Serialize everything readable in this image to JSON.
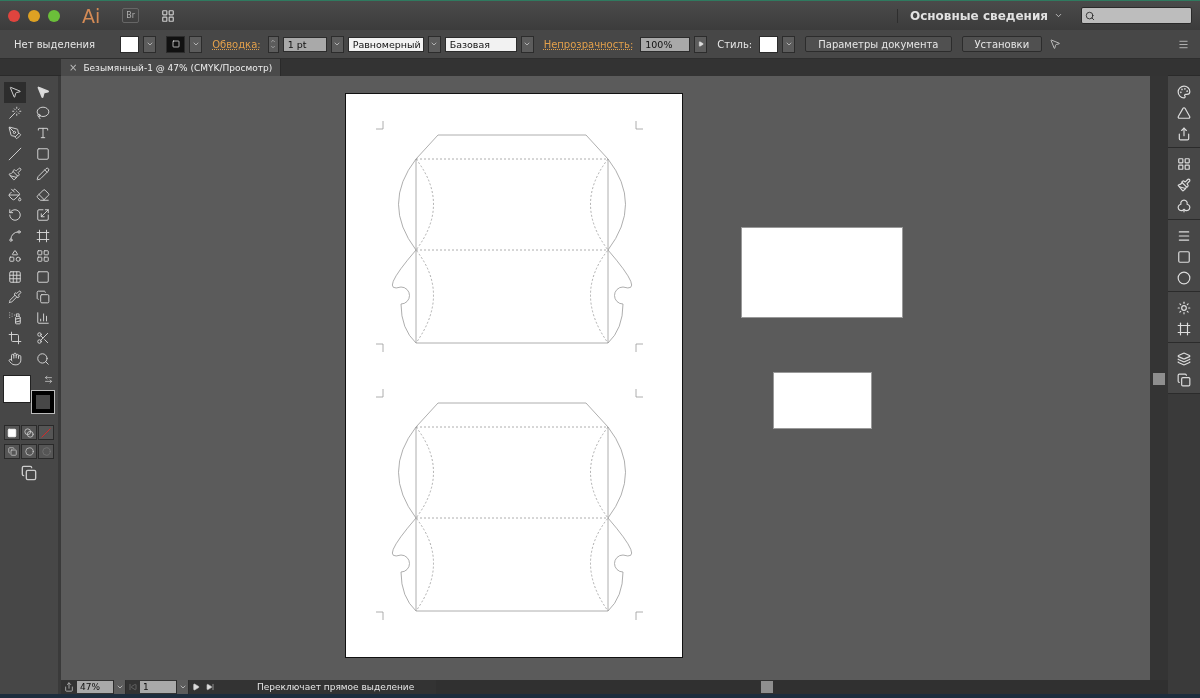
{
  "app": {
    "logo": "Ai",
    "bridge": "Br"
  },
  "workspace": {
    "label": "Основные сведения"
  },
  "control_bar": {
    "selection": "Нет выделения",
    "stroke_label": "Обводка:",
    "stroke_weight": "1 pt",
    "profile": "Равномерный",
    "brush": "Базовая",
    "opacity_label": "Непрозрачность:",
    "opacity": "100%",
    "style_label": "Стиль:",
    "buttons": [
      "Параметры документа",
      "Установки"
    ]
  },
  "document_tab": {
    "close": "×",
    "title": "Безымянный-1 @ 47% (CMYK/Просмотр)"
  },
  "tools": [
    {
      "kind": "selection",
      "selected": true
    },
    {
      "kind": "direct",
      "selected": false
    },
    {
      "kind": "wand",
      "selected": false
    },
    {
      "kind": "lasso",
      "selected": false
    },
    {
      "kind": "pen",
      "selected": false
    },
    {
      "kind": "type",
      "selected": false
    },
    {
      "kind": "line",
      "selected": false
    },
    {
      "kind": "rectangle",
      "selected": false
    },
    {
      "kind": "brush",
      "selected": false
    },
    {
      "kind": "pencil",
      "selected": false
    },
    {
      "kind": "blob",
      "selected": false
    },
    {
      "kind": "eraser",
      "selected": false
    },
    {
      "kind": "rotate",
      "selected": false
    },
    {
      "kind": "scale",
      "selected": false
    },
    {
      "kind": "warp",
      "selected": false
    },
    {
      "kind": "transform",
      "selected": false
    },
    {
      "kind": "shapes",
      "selected": false
    },
    {
      "kind": "perspective",
      "selected": false
    },
    {
      "kind": "mesh",
      "selected": false
    },
    {
      "kind": "gradient",
      "selected": false
    },
    {
      "kind": "eyedropper",
      "selected": false
    },
    {
      "kind": "blend",
      "selected": false
    },
    {
      "kind": "spray",
      "selected": false
    },
    {
      "kind": "graph",
      "selected": false
    },
    {
      "kind": "artboard",
      "selected": false
    },
    {
      "kind": "slice",
      "selected": false
    },
    {
      "kind": "hand",
      "selected": false
    },
    {
      "kind": "zoom",
      "selected": false
    }
  ],
  "status_bar": {
    "zoom": "47%",
    "artboard": "1",
    "message": "Переключает прямое выделение"
  }
}
